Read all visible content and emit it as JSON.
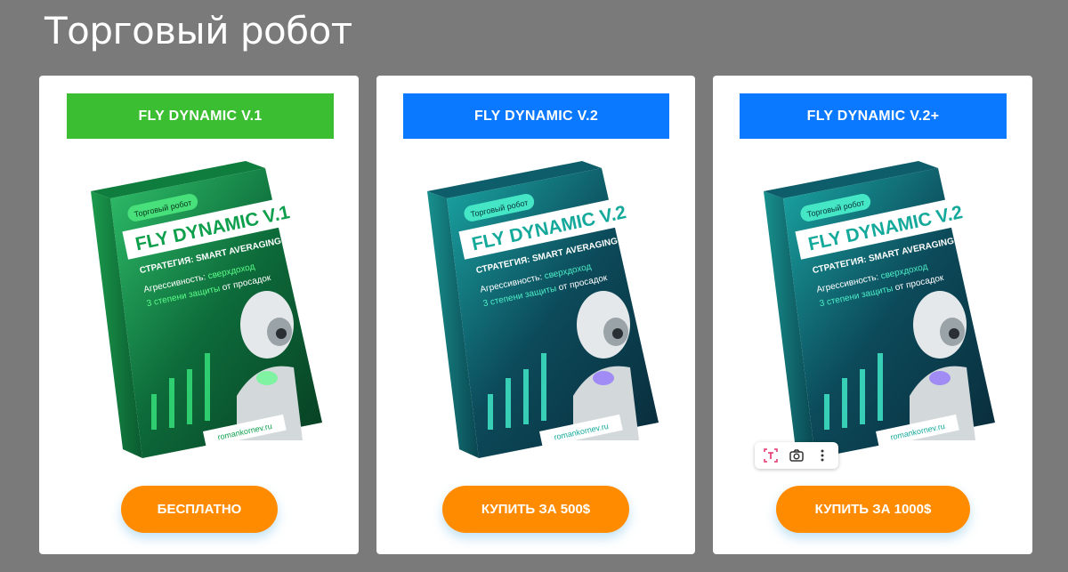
{
  "page": {
    "title": "Торговый робот"
  },
  "colors": {
    "background": "#7a7a7a",
    "card": "#ffffff",
    "label_green": "#3cbe32",
    "label_blue": "#0a78ff",
    "button_orange": "#ff8c00"
  },
  "products": [
    {
      "label": "FLY DYNAMIC V.1",
      "label_color": "#3cbe32",
      "button": "БЕСПЛАТНО",
      "box": {
        "badge": "Торговый робот",
        "title": "FLY DYNAMIC V.1",
        "strategy": "СТРАТЕГИЯ: SMART AVERAGING",
        "line1_prefix": "Агрессивность: ",
        "line1_accent": "сверхдоход",
        "line2_accent": "3 степени защиты",
        "line2_suffix": " от просадок",
        "site": "romankornev.ru",
        "theme": "green"
      }
    },
    {
      "label": "FLY DYNAMIC V.2",
      "label_color": "#0a78ff",
      "button": "КУПИТЬ ЗА 500$",
      "box": {
        "badge": "Торговый робот",
        "title": "FLY DYNAMIC V.2",
        "strategy": "СТРАТЕГИЯ: SMART AVERAGING",
        "line1_prefix": "Агрессивность: ",
        "line1_accent": "сверхдоход",
        "line2_accent": "3 степени защиты",
        "line2_suffix": " от просадок",
        "site": "romankornev.ru",
        "theme": "teal"
      }
    },
    {
      "label": "FLY DYNAMIC V.2+",
      "label_color": "#0a78ff",
      "button": "КУПИТЬ ЗА 1000$",
      "box": {
        "badge": "Торговый робот",
        "title": "FLY DYNAMIC V.2",
        "strategy": "СТРАТЕГИЯ: SMART AVERAGING",
        "line1_prefix": "Агрессивность: ",
        "line1_accent": "сверхдоход",
        "line2_accent": "3 степени защиты",
        "line2_suffix": " от просадок",
        "site": "romankornev.ru",
        "theme": "teal"
      }
    }
  ],
  "overlay_toolbar": {
    "icons": [
      "text-select-icon",
      "camera-icon",
      "more-vertical-icon"
    ]
  }
}
